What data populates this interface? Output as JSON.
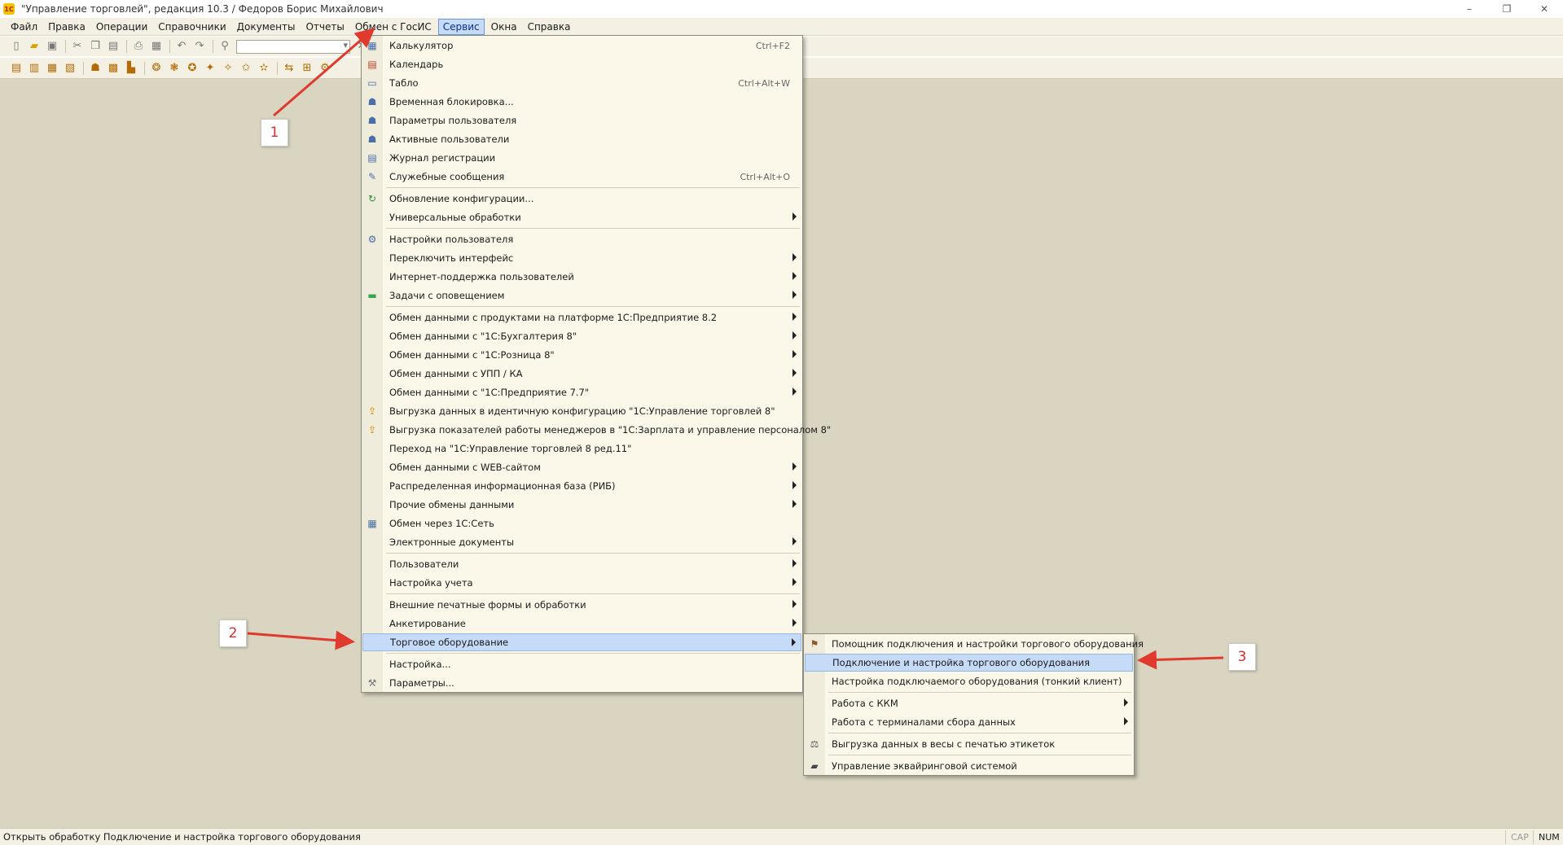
{
  "window": {
    "title": "\"Управление торговлей\", редакция 10.3 / Федоров Борис Михайлович",
    "app_icon_text": "1С",
    "controls": {
      "minimize": "–",
      "restore": "❐",
      "close": "✕"
    }
  },
  "menubar": {
    "items": [
      "Файл",
      "Правка",
      "Операции",
      "Справочники",
      "Документы",
      "Отчеты",
      "Обмен с ГосИС",
      "Сервис",
      "Окна",
      "Справка"
    ],
    "active": "Сервис"
  },
  "service_menu": {
    "items": [
      {
        "label": "Калькулятор",
        "shortcut": "Ctrl+F2",
        "icon": "calculator-icon"
      },
      {
        "label": "Календарь",
        "icon": "calendar-icon"
      },
      {
        "label": "Табло",
        "shortcut": "Ctrl+Alt+W",
        "icon": "display-board-icon"
      },
      {
        "label": "Временная блокировка...",
        "icon": "lock-user-icon"
      },
      {
        "label": "Параметры пользователя",
        "icon": "user-params-icon"
      },
      {
        "label": "Активные пользователи",
        "icon": "active-users-icon"
      },
      {
        "label": "Журнал регистрации",
        "icon": "log-icon"
      },
      {
        "label": "Служебные сообщения",
        "shortcut": "Ctrl+Alt+O",
        "icon": "messages-icon"
      },
      {
        "label": "Обновление конфигурации...",
        "icon": "update-icon"
      },
      {
        "label": "Универсальные обработки",
        "submenu": true
      },
      {
        "label": "Настройки пользователя",
        "icon": "user-settings-icon"
      },
      {
        "label": "Переключить интерфейс",
        "submenu": true
      },
      {
        "label": "Интернет-поддержка пользователей",
        "submenu": true
      },
      {
        "label": "Задачи с оповещением",
        "submenu": true,
        "icon": "tasks-icon"
      },
      {
        "label": "Обмен данными с продуктами на платформе 1С:Предприятие 8.2",
        "submenu": true
      },
      {
        "label": "Обмен данными с \"1С:Бухгалтерия 8\"",
        "submenu": true
      },
      {
        "label": "Обмен данными с \"1С:Розница 8\"",
        "submenu": true
      },
      {
        "label": "Обмен данными с УПП / КА",
        "submenu": true
      },
      {
        "label": "Обмен данными с \"1С:Предприятие 7.7\"",
        "submenu": true
      },
      {
        "label": "Выгрузка данных в идентичную конфигурацию \"1С:Управление торговлей 8\"",
        "icon": "export-icon"
      },
      {
        "label": "Выгрузка показателей работы менеджеров в \"1С:Зарплата и управление персоналом 8\"",
        "icon": "export-icon"
      },
      {
        "label": "Переход на \"1С:Управление торговлей 8 ред.11\""
      },
      {
        "label": "Обмен данными с WEB-сайтом",
        "submenu": true
      },
      {
        "label": "Распределенная информационная база (РИБ)",
        "submenu": true
      },
      {
        "label": "Прочие обмены данными",
        "submenu": true
      },
      {
        "label": "Обмен через 1С:Сеть",
        "icon": "network-icon"
      },
      {
        "label": "Электронные документы",
        "submenu": true
      },
      {
        "label": "Пользователи",
        "submenu": true
      },
      {
        "label": "Настройка учета",
        "submenu": true
      },
      {
        "label": "Внешние печатные формы и обработки",
        "submenu": true
      },
      {
        "label": "Анкетирование",
        "submenu": true
      },
      {
        "label": "Торговое оборудование",
        "submenu": true,
        "highlighted": true
      },
      {
        "label": "Настройка..."
      },
      {
        "label": "Параметры...",
        "icon": "wrench-icon"
      }
    ]
  },
  "equipment_submenu": {
    "items": [
      {
        "label": "Помощник подключения и настройки торгового оборудования",
        "icon": "wizard-icon"
      },
      {
        "label": "Подключение и настройка торгового оборудования",
        "highlighted": true
      },
      {
        "label": "Настройка подключаемого оборудования (тонкий клиент)"
      },
      {
        "label": "Работа с ККМ",
        "submenu": true
      },
      {
        "label": "Работа с терминалами сбора данных",
        "submenu": true
      },
      {
        "label": "Выгрузка данных в весы с печатью этикеток",
        "icon": "scales-icon"
      },
      {
        "label": "Управление эквайринговой системой",
        "icon": "card-terminal-icon"
      }
    ]
  },
  "annotations": {
    "callout_1": "1",
    "callout_2": "2",
    "callout_3": "3",
    "arrow_color": "#e03a2e"
  },
  "statusbar": {
    "text": "Открыть обработку Подключение и настройка торгового оборудования",
    "cap": "CAP",
    "num": "NUM"
  },
  "colors": {
    "workspace": "#d9d5c0",
    "menu_bg": "#fbf8ea",
    "highlight": "#c6dbf7"
  }
}
